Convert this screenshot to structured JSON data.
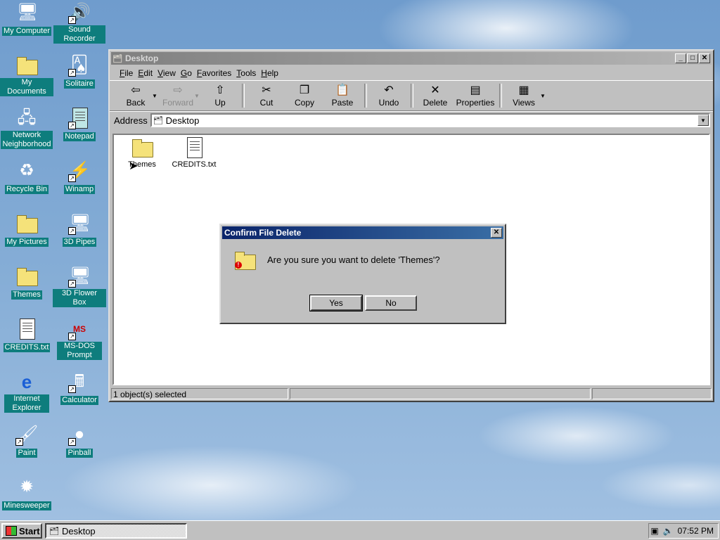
{
  "desktop": {
    "icons": [
      {
        "label": "My Computer",
        "icon": "computer-icon"
      },
      {
        "label": "Sound Recorder",
        "icon": "sound-recorder-icon"
      },
      {
        "label": "My Documents",
        "icon": "folder-icon"
      },
      {
        "label": "Solitaire",
        "icon": "solitaire-icon"
      },
      {
        "label": "Network Neighborhood",
        "icon": "network-icon"
      },
      {
        "label": "Notepad",
        "icon": "notepad-icon"
      },
      {
        "label": "Recycle Bin",
        "icon": "recycle-bin-icon"
      },
      {
        "label": "Winamp",
        "icon": "winamp-icon"
      },
      {
        "label": "My Pictures",
        "icon": "folder-icon"
      },
      {
        "label": "3D Pipes",
        "icon": "screensaver-icon"
      },
      {
        "label": "Themes",
        "icon": "folder-icon"
      },
      {
        "label": "3D Flower Box",
        "icon": "screensaver-icon"
      },
      {
        "label": "CREDITS.txt",
        "icon": "text-file-icon"
      },
      {
        "label": "MS-DOS Prompt",
        "icon": "msdos-icon"
      },
      {
        "label": "Internet Explorer",
        "icon": "ie-icon"
      },
      {
        "label": "Calculator",
        "icon": "calculator-icon"
      },
      {
        "label": "Paint",
        "icon": "paint-icon"
      },
      {
        "label": "Pinball",
        "icon": "pinball-icon"
      },
      {
        "label": "Minesweeper",
        "icon": "minesweeper-icon"
      }
    ]
  },
  "window": {
    "title": "Desktop",
    "menu": [
      "File",
      "Edit",
      "View",
      "Go",
      "Favorites",
      "Tools",
      "Help"
    ],
    "toolbar": {
      "back": "Back",
      "forward": "Forward",
      "up": "Up",
      "cut": "Cut",
      "copy": "Copy",
      "paste": "Paste",
      "undo": "Undo",
      "delete": "Delete",
      "properties": "Properties",
      "views": "Views"
    },
    "address_label": "Address",
    "address_value": "Desktop",
    "files": [
      {
        "name": "Themes",
        "icon": "folder-icon"
      },
      {
        "name": "CREDITS.txt",
        "icon": "text-file-icon"
      }
    ],
    "status": "1 object(s) selected"
  },
  "dialog": {
    "title": "Confirm File Delete",
    "message": "Are you sure you want to delete 'Themes'?",
    "yes": "Yes",
    "no": "No"
  },
  "taskbar": {
    "start": "Start",
    "task": "Desktop",
    "clock": "07:52 PM"
  }
}
